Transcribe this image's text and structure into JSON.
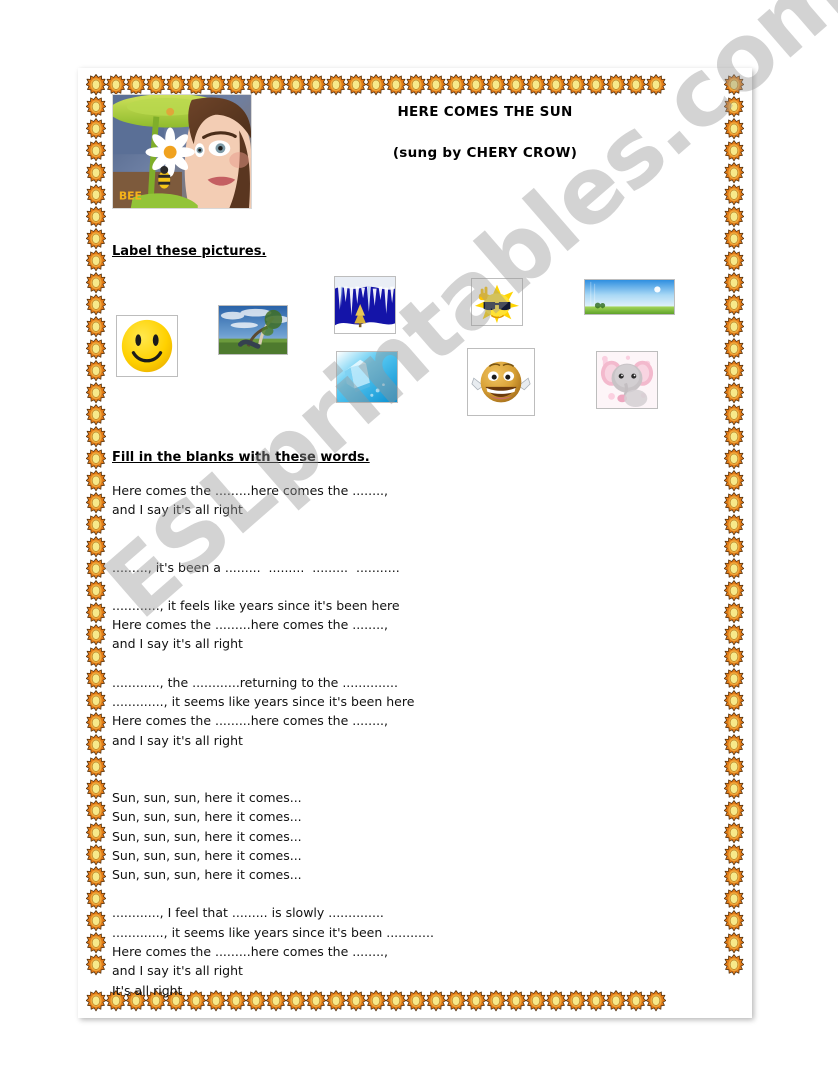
{
  "document": {
    "title_main": "HERE COMES THE SUN",
    "title_sub": "(sung by CHERY CROW)",
    "watermark": "ESLprintables.com"
  },
  "hero": {
    "icon": "bee-movie-girl-photo",
    "caption": "BEE"
  },
  "sections": {
    "label_pictures_heading": "Label these pictures.",
    "fill_blanks_heading": "Fill in the blanks with these words."
  },
  "pictures": [
    {
      "name": "smiley-face-picture",
      "icon": "smiley-face-icon"
    },
    {
      "name": "storm-tree-picture",
      "icon": "storm-landscape-icon"
    },
    {
      "name": "icicles-winter-picture",
      "icon": "icicles-icon"
    },
    {
      "name": "sun-sunglasses-picture",
      "icon": "cool-sun-icon"
    },
    {
      "name": "blue-sky-picture",
      "icon": "blue-sky-icon"
    },
    {
      "name": "ice-cube-picture",
      "icon": "ice-cube-icon"
    },
    {
      "name": "laughing-face-picture",
      "icon": "laughing-face-icon"
    },
    {
      "name": "pink-elephant-picture",
      "icon": "pink-elephant-icon"
    }
  ],
  "lyrics": [
    "Here comes the .........here comes the ........,",
    "and I say it's all right",
    "",
    "",
    "........., it's been a .........  .........  .........  ...........",
    "",
    "............, it feels like years since it's been here",
    "Here comes the .........here comes the ........,",
    "and I say it's all right",
    "",
    "............, the ............returning to the ..............",
    "............., it seems like years since it's been here",
    "Here comes the .........here comes the ........,",
    "and I say it's all right",
    "",
    "",
    "Sun, sun, sun, here it comes...",
    "Sun, sun, sun, here it comes...",
    "Sun, sun, sun, here it comes...",
    "Sun, sun, sun, here it comes...",
    "Sun, sun, sun, here it comes...",
    "",
    "............, I feel that ......... is slowly ..............",
    "............., it seems like years since it's been ............",
    "Here comes the .........here comes the ........,",
    "and I say it's all right",
    "It's all right"
  ],
  "colors": {
    "sun_outer": "#e07a18",
    "sun_inner": "#f7e98a",
    "sun_mid": "#f0a93c",
    "page_bg": "#ffffff",
    "text": "#111111",
    "watermark": "#969696"
  },
  "border": {
    "icon": "sun-flower-icon",
    "top_count": 29,
    "bottom_count": 29,
    "side_count": 41
  }
}
